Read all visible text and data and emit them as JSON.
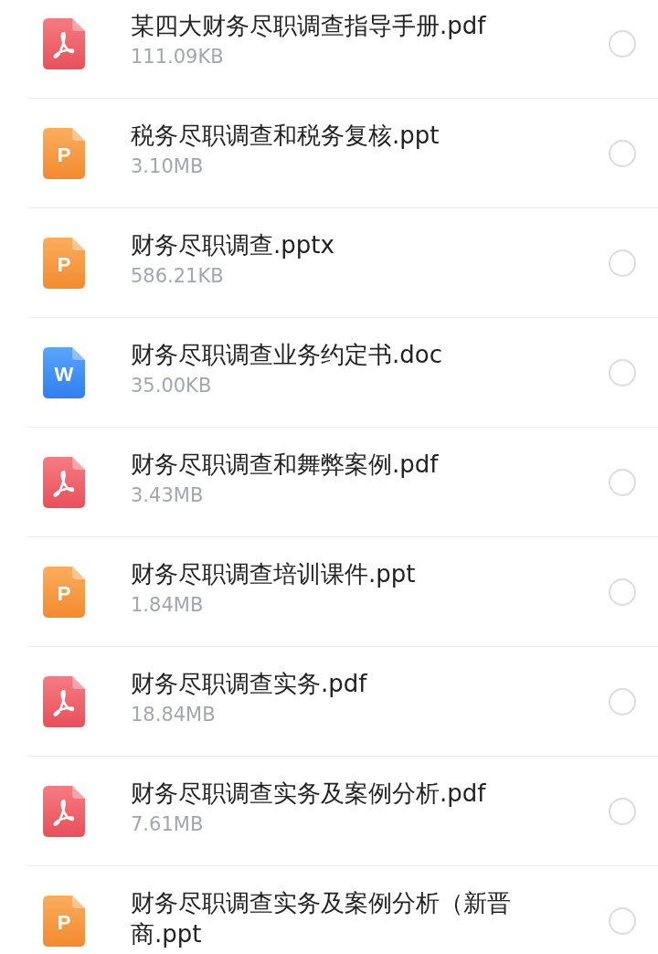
{
  "files": [
    {
      "name": "某四大财务尽职调查指导手册.pdf",
      "size": "111.09KB",
      "kind": "pdf",
      "selected": false
    },
    {
      "name": "税务尽职调查和税务复核.ppt",
      "size": "3.10MB",
      "kind": "ppt",
      "badge": "P",
      "selected": false
    },
    {
      "name": "财务尽职调查.pptx",
      "size": "586.21KB",
      "kind": "ppt",
      "badge": "P",
      "selected": false
    },
    {
      "name": "财务尽职调查业务约定书.doc",
      "size": "35.00KB",
      "kind": "doc",
      "badge": "W",
      "selected": false
    },
    {
      "name": "财务尽职调查和舞弊案例.pdf",
      "size": "3.43MB",
      "kind": "pdf",
      "selected": false
    },
    {
      "name": "财务尽职调查培训课件.ppt",
      "size": "1.84MB",
      "kind": "ppt",
      "badge": "P",
      "selected": false
    },
    {
      "name": "财务尽职调查实务.pdf",
      "size": "18.84MB",
      "kind": "pdf",
      "selected": false
    },
    {
      "name": "财务尽职调查实务及案例分析.pdf",
      "size": "7.61MB",
      "kind": "pdf",
      "selected": false
    },
    {
      "name": "财务尽职调查实务及案例分析（新晋商.ppt",
      "kind": "ppt",
      "badge": "P",
      "selected": false
    }
  ]
}
